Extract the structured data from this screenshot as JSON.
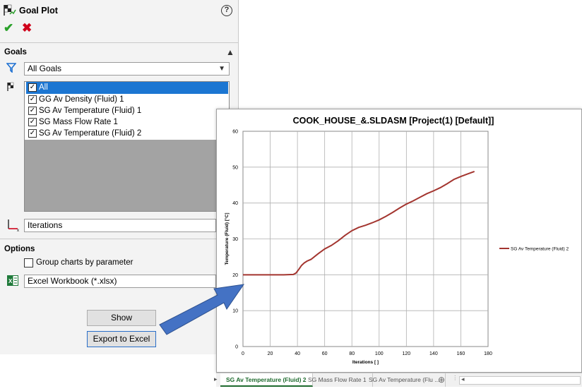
{
  "panel": {
    "title": "Goal Plot",
    "goals_section": "Goals",
    "filter_value": "All Goals",
    "goal_items": [
      {
        "label": "All",
        "checked": true,
        "selected": true
      },
      {
        "label": "GG Av Density (Fluid) 1",
        "checked": true,
        "selected": false
      },
      {
        "label": "SG Av Temperature (Fluid) 1",
        "checked": true,
        "selected": false
      },
      {
        "label": "SG Mass Flow Rate 1",
        "checked": true,
        "selected": false
      },
      {
        "label": "SG Av Temperature (Fluid) 2",
        "checked": true,
        "selected": false
      }
    ],
    "x_axis_value": "Iterations",
    "options_section": "Options",
    "group_charts_label": "Group charts by parameter",
    "group_charts_checked": false,
    "export_format_value": "Excel Workbook (*.xlsx)",
    "show_button": "Show",
    "export_button": "Export to Excel"
  },
  "sheet_tabs": {
    "nav_left": "▸",
    "tabs": [
      "SG Av Temperature (Fluid) 2",
      "SG Mass Flow Rate 1",
      "SG Av Temperature (Flu ..."
    ],
    "active_index": 0,
    "add_icon": "⊕",
    "scroll_left": "◂"
  },
  "chart_data": {
    "type": "line",
    "title": "COOK_HOUSE_&.SLDASM [Project(1) [Default]]",
    "xlabel": "Iterations [ ]",
    "ylabel": "Temperature (Fluid) [°C]",
    "xlim": [
      0,
      180
    ],
    "ylim": [
      0,
      60
    ],
    "xticks": [
      0,
      20,
      40,
      60,
      80,
      100,
      120,
      140,
      160,
      180
    ],
    "yticks": [
      0,
      10,
      20,
      30,
      40,
      50,
      60
    ],
    "grid": true,
    "legend_position": "right",
    "series": [
      {
        "name": "SG Av Temperature (Fluid) 2",
        "color": "#a3352f",
        "x": [
          0,
          10,
          20,
          30,
          37,
          39,
          41,
          43,
          45,
          47,
          50,
          55,
          60,
          65,
          70,
          75,
          80,
          85,
          90,
          95,
          100,
          105,
          110,
          115,
          120,
          125,
          130,
          135,
          140,
          145,
          150,
          155,
          160,
          165,
          170
        ],
        "y": [
          20,
          20,
          20,
          20,
          20.1,
          20.5,
          21.5,
          22.6,
          23.3,
          23.8,
          24.3,
          25.8,
          27.2,
          28.2,
          29.5,
          31,
          32.3,
          33.2,
          33.8,
          34.5,
          35.3,
          36.3,
          37.4,
          38.6,
          39.7,
          40.6,
          41.6,
          42.6,
          43.4,
          44.3,
          45.4,
          46.6,
          47.4,
          48.1,
          48.8
        ]
      }
    ]
  }
}
